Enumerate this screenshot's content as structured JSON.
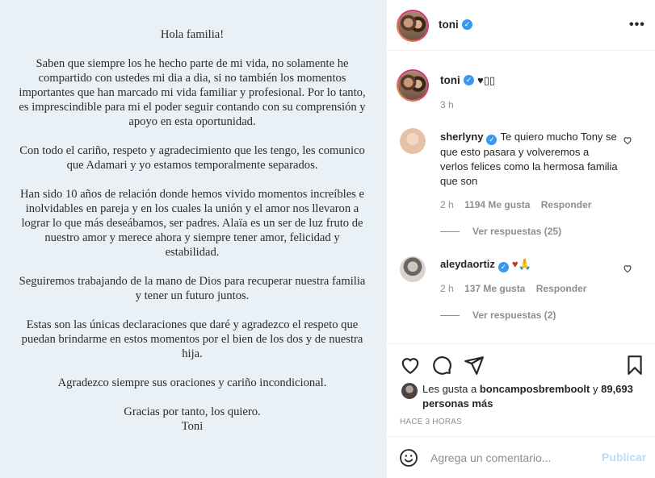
{
  "letter": {
    "greeting": "Hola familia!",
    "p1": "Saben que siempre los he hecho parte de mi vida, no solamente he compartido con ustedes mi dia a dia, si no también los momentos importantes que han marcado mi vida familiar y profesional. Por lo tanto, es imprescindible para mi el poder seguir contando con su comprensión y apoyo en esta oportunidad.",
    "p2": "Con todo el cariño, respeto y agradecimiento que les tengo, les comunico que Adamari y yo estamos temporalmente separados.",
    "p3": "Han sido 10 años de relación donde hemos vivido momentos increíbles e inolvidables en pareja y en los cuales la unión y el amor nos llevaron a lograr lo que más deseábamos, ser padres. Alaïa es un ser de luz fruto de nuestro amor y merece ahora y siempre tener amor, felicidad y estabilidad.",
    "p4": "Seguiremos trabajando de la mano de Dios para recuperar nuestra familia y tener un futuro juntos.",
    "p5": "Estas son las únicas declaraciones que daré y agradezco el respeto que puedan brindarme en estos momentos por el bien de los dos y de nuestra hija.",
    "p6": "Agradezco siempre sus oraciones y cariño incondicional.",
    "closing": "Gracias por tanto, los quiero.",
    "signature": "Toni"
  },
  "header": {
    "username": "toni",
    "verified_glyph": "✓",
    "more_glyph": "•••"
  },
  "caption": {
    "username": "toni",
    "text": "♥▯▯",
    "time": "3 h"
  },
  "comments": [
    {
      "username": "sherlyny",
      "text": "Te quiero mucho Tony se que esto pasara y volveremos a verlos felices como la hermosa familia que son",
      "time": "2 h",
      "likes": "1194 Me gusta",
      "reply": "Responder",
      "replies": "Ver respuestas (25)"
    },
    {
      "username": "aleydaortiz",
      "text": "♥🙏",
      "time": "2 h",
      "likes": "137 Me gusta",
      "reply": "Responder",
      "replies": "Ver respuestas (2)"
    }
  ],
  "likes": {
    "prefix": "Les gusta a",
    "user": "boncamposbremboolt",
    "connector": "y",
    "count": "89,693 personas más"
  },
  "posted_ago": "HACE 3 HORAS",
  "add_comment": {
    "placeholder": "Agrega un comentario...",
    "publish": "Publicar"
  },
  "colors": {
    "image_bg": "#e9f1f7",
    "verified": "#3897f0",
    "publish_disabled": "#b2dffc",
    "muted": "#8e8e8e"
  }
}
